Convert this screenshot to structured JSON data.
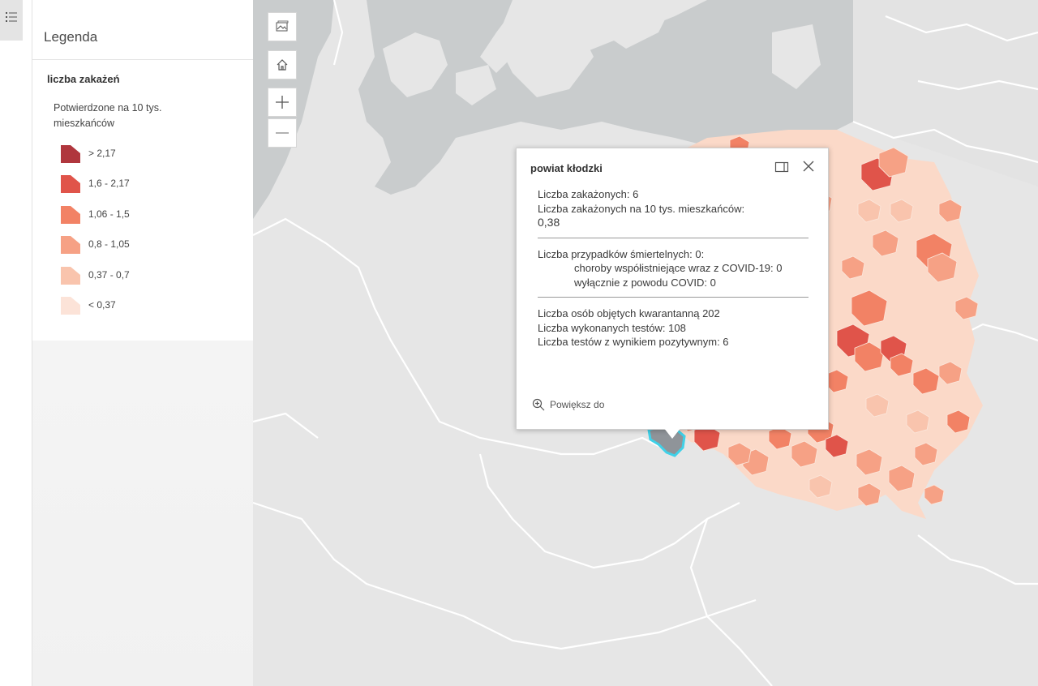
{
  "legend": {
    "title": "Legenda",
    "layer_title": "liczba zakażeń",
    "field_label": "Potwierdzone na 10 tys. mieszkańców",
    "classes": [
      {
        "label": "> 2,17",
        "color": "#b0363d"
      },
      {
        "label": "1,6 - 2,17",
        "color": "#e0544a"
      },
      {
        "label": "1,06 - 1,5",
        "color": "#f28265"
      },
      {
        "label": "0,8 - 1,05",
        "color": "#f6a185"
      },
      {
        "label": "0,37 - 0,7",
        "color": "#f9c4ad"
      },
      {
        "label": "< 0,37",
        "color": "#fce3d8"
      }
    ]
  },
  "map_controls": {
    "basemap_icon": "basemap-gallery-icon",
    "home_icon": "home-icon",
    "zoom_in": "+",
    "zoom_out": "−"
  },
  "popup": {
    "title": "powiat kłodzki",
    "section1": {
      "infections": "Liczba zakażonych: 6",
      "per10k_label": "Liczba zakażonych na 10 tys. mieszkańców:",
      "per10k_value": "0,38"
    },
    "section2": {
      "deaths": "Liczba przypadków śmiertelnych: 0:",
      "comorb": "choroby współistniejące wraz z COVID-19: 0",
      "covid_only": "wyłącznie z powodu COVID: 0"
    },
    "section3": {
      "quarantine": "Liczba osób objętych kwarantanną 202",
      "tests": "Liczba wykonanych testów: 108",
      "positive": "Liczba testów z wynikiem pozytywnym: 6"
    },
    "zoom_to": "Powiększ do"
  },
  "colors": {
    "water": "#c8cbcc",
    "land": "#e6e6e6",
    "highlight": "#3fd1e8"
  }
}
